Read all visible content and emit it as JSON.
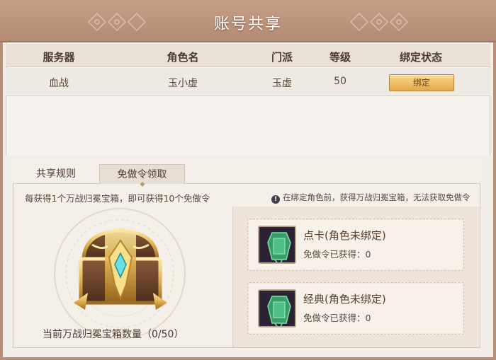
{
  "title": "账号共享",
  "table": {
    "headers": [
      "服务器",
      "角色名",
      "门派",
      "等级",
      "绑定状态"
    ],
    "row": {
      "server": "血战",
      "role_name": "玉小虚",
      "faction": "玉虚",
      "level": "50",
      "bind_button": "绑定"
    }
  },
  "tabs": [
    {
      "label": "共享规则",
      "active": false
    },
    {
      "label": "免做令领取",
      "active": true
    }
  ],
  "hint_left": "每获得1个万战归冕宝箱，即可获得10个免做令",
  "hint_right": "在绑定角色前，获得万战归冕宝箱，无法获取免做令",
  "chest_count": "当前万战归冕宝箱数量（0/50）",
  "cards": [
    {
      "name": "点卡(角色未绑定)",
      "sub": "免做令已获得：0"
    },
    {
      "name": "经典(角色未绑定)",
      "sub": "免做令已获得：0"
    }
  ],
  "colors": {
    "title_bar": "#b9907a",
    "button_gold": "#e6a84a",
    "panel_bg": "#f3eee8"
  }
}
